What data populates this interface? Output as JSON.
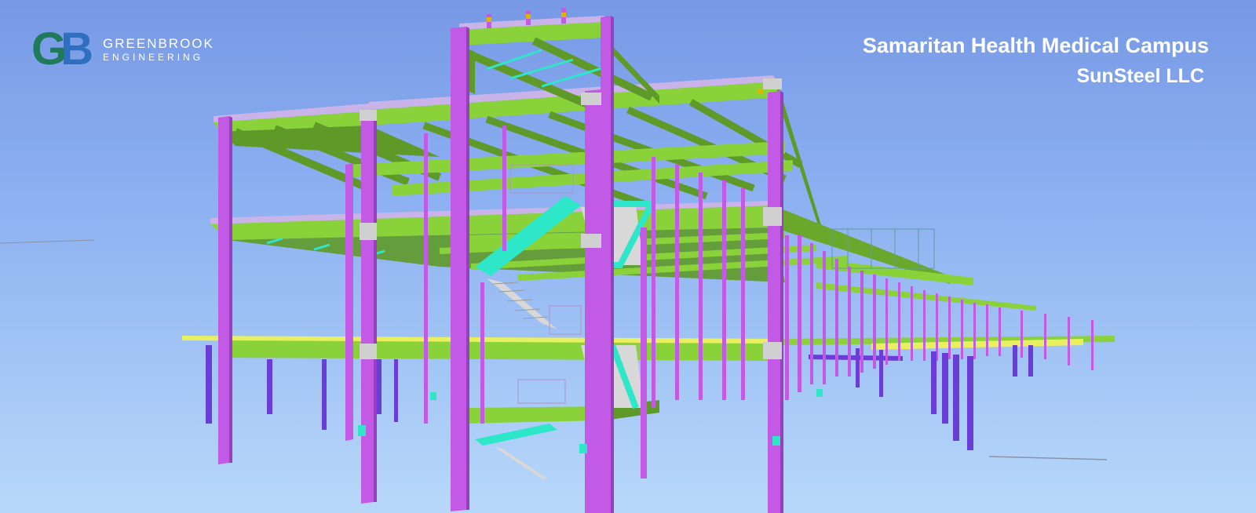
{
  "logo": {
    "mark_g": "G",
    "mark_b": "B",
    "line1": "GREENBROOK",
    "line2": "ENGINEERING",
    "colors": {
      "green": "#1f7a5a",
      "blue": "#2f6fc0"
    }
  },
  "header": {
    "title": "Samaritan Health Medical Campus",
    "subtitle": "SunSteel LLC"
  },
  "colors": {
    "sky_top": "#7799e6",
    "sky_bottom": "#b8d8fa",
    "beam_green": "#8ad23a",
    "column_magenta": "#c35ae6",
    "stair_cyan": "#2ee6c8",
    "post_purple": "#6a3cd8",
    "slab_yellow": "#e8f060"
  }
}
